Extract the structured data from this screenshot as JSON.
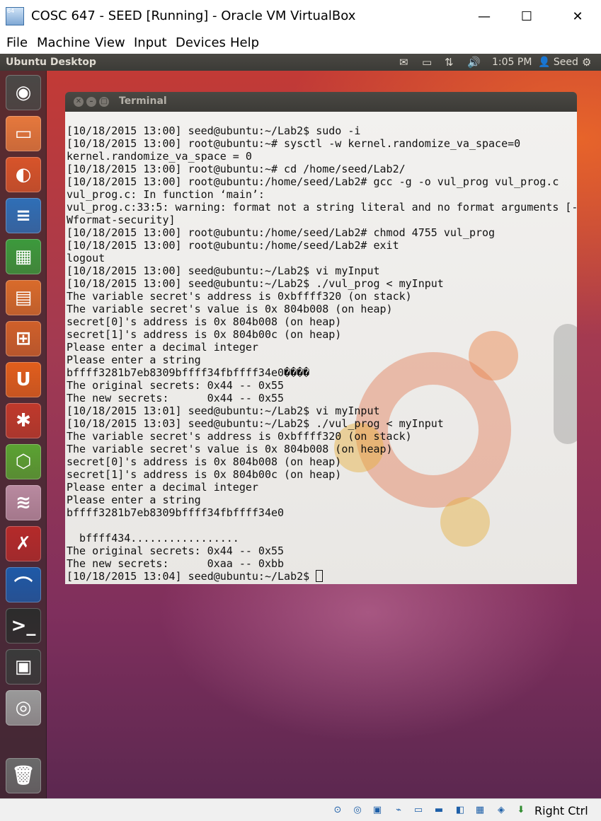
{
  "host_window": {
    "title": "COSC 647 - SEED [Running] - Oracle VM VirtualBox",
    "icon_badge": "64",
    "minimize_label": "—",
    "maximize_label": "☐",
    "close_label": "✕"
  },
  "menu": [
    "File",
    "Machine",
    "View",
    "Input",
    "Devices",
    "Help"
  ],
  "unity_panel": {
    "title": "Ubuntu Desktop",
    "clock": "1:05 PM",
    "user": "Seed",
    "icons": [
      "mail-icon",
      "battery-icon",
      "network-icon",
      "volume-icon",
      "settings-gear-icon"
    ]
  },
  "launcher": [
    {
      "name": "dash-home-icon",
      "glyph": "◉",
      "color": "#4a4846"
    },
    {
      "name": "files-icon",
      "glyph": "▭",
      "color": "#e6783c"
    },
    {
      "name": "firefox-icon",
      "glyph": "◐",
      "color": "#d8542a"
    },
    {
      "name": "libreoffice-writer-icon",
      "glyph": "≡",
      "color": "#2f6fb7"
    },
    {
      "name": "libreoffice-calc-icon",
      "glyph": "▦",
      "color": "#3c9a3c"
    },
    {
      "name": "libreoffice-impress-icon",
      "glyph": "▤",
      "color": "#d96b2b"
    },
    {
      "name": "software-center-icon",
      "glyph": "⊞",
      "color": "#d0602a"
    },
    {
      "name": "ubuntu-one-icon",
      "glyph": "U",
      "color": "#e25e1c"
    },
    {
      "name": "system-settings-icon",
      "glyph": "✱",
      "color": "#c0392b"
    },
    {
      "name": "hex-app-icon",
      "glyph": "⬡",
      "color": "#5ba332"
    },
    {
      "name": "spring-app-icon",
      "glyph": "≋",
      "color": "#b98aa0"
    },
    {
      "name": "tool-app-icon",
      "glyph": "✗",
      "color": "#b52a2a"
    },
    {
      "name": "wireshark-icon",
      "glyph": "⌒",
      "color": "#1e5aa8"
    },
    {
      "name": "terminal-icon",
      "glyph": ">_",
      "color": "#2c2c2c"
    },
    {
      "name": "workspace-switcher-icon",
      "glyph": "▣",
      "color": "#3a3a3a"
    },
    {
      "name": "dvd-drive-icon",
      "glyph": "◎",
      "color": "#9a9a9a"
    },
    {
      "name": "trash-icon",
      "glyph": "🗑",
      "color": "#6a6a6a"
    }
  ],
  "terminal": {
    "title": "Terminal",
    "lines": [
      "[10/18/2015 13:00] seed@ubuntu:~/Lab2$ sudo -i",
      "[10/18/2015 13:00] root@ubuntu:~# sysctl -w kernel.randomize_va_space=0",
      "kernel.randomize_va_space = 0",
      "[10/18/2015 13:00] root@ubuntu:~# cd /home/seed/Lab2/",
      "[10/18/2015 13:00] root@ubuntu:/home/seed/Lab2# gcc -g -o vul_prog vul_prog.c",
      "vul_prog.c: In function ‘main’:",
      "vul_prog.c:33:5: warning: format not a string literal and no format arguments [-",
      "Wformat-security]",
      "[10/18/2015 13:00] root@ubuntu:/home/seed/Lab2# chmod 4755 vul_prog",
      "[10/18/2015 13:00] root@ubuntu:/home/seed/Lab2# exit",
      "logout",
      "[10/18/2015 13:00] seed@ubuntu:~/Lab2$ vi myInput",
      "[10/18/2015 13:00] seed@ubuntu:~/Lab2$ ./vul_prog < myInput",
      "The variable secret's address is 0xbffff320 (on stack)",
      "The variable secret's value is 0x 804b008 (on heap)",
      "secret[0]'s address is 0x 804b008 (on heap)",
      "secret[1]'s address is 0x 804b00c (on heap)",
      "Please enter a decimal integer",
      "Please enter a string",
      "bffff3281b7eb8309bffff34fbffff34e0����",
      "The original secrets: 0x44 -- 0x55",
      "The new secrets:      0x44 -- 0x55",
      "[10/18/2015 13:01] seed@ubuntu:~/Lab2$ vi myInput",
      "[10/18/2015 13:03] seed@ubuntu:~/Lab2$ ./vul_prog < myInput",
      "The variable secret's address is 0xbffff320 (on stack)",
      "The variable secret's value is 0x 804b008 (on heap)",
      "secret[0]'s address is 0x 804b008 (on heap)",
      "secret[1]'s address is 0x 804b00c (on heap)",
      "Please enter a decimal integer",
      "Please enter a string",
      "bffff3281b7eb8309bffff34fbffff34e0",
      "",
      "  bffff434.................",
      "The original secrets: 0x44 -- 0x55",
      "The new secrets:      0xaa -- 0xbb"
    ],
    "prompt": "[10/18/2015 13:04] seed@ubuntu:~/Lab2$ "
  },
  "status_bar": {
    "icons": [
      "hard-disk-icon",
      "optical-drive-icon",
      "network-adapter-icon",
      "usb-icon",
      "shared-folders-icon",
      "display-icon",
      "video-capture-icon",
      "cpu-icon",
      "mouse-integration-icon",
      "keyboard-capture-icon"
    ],
    "host_key": "Right Ctrl"
  }
}
